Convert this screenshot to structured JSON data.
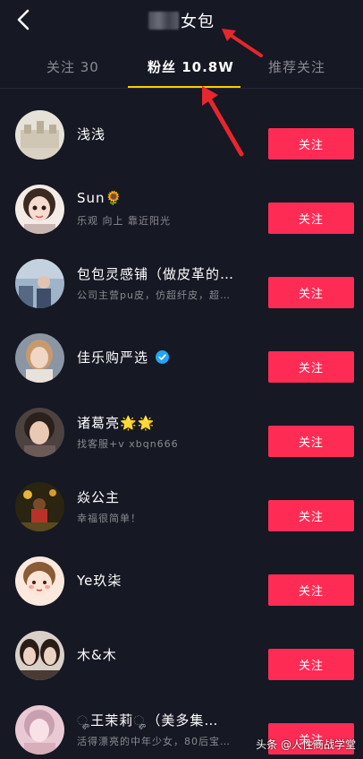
{
  "header": {
    "title_visible": "女包"
  },
  "tabs": [
    {
      "label": "关注 30"
    },
    {
      "label": "粉丝 10.8W"
    },
    {
      "label": "推荐关注"
    }
  ],
  "follow_label": "关注",
  "users": [
    {
      "name": "浅浅",
      "sub": ""
    },
    {
      "name": "Sun🌻",
      "sub": "乐观   向上   靠近阳光"
    },
    {
      "name": "包包灵感铺（做皮革的…",
      "sub": "公司主营pu皮，仿超纤皮，超…"
    },
    {
      "name": "佳乐购严选",
      "sub": "",
      "verified": true
    },
    {
      "name": "诸葛亮🌟🌟",
      "sub": "找客服+v   xbqn666"
    },
    {
      "name": "焱公主",
      "sub": "幸福很简单！"
    },
    {
      "name": "Ye玖柒",
      "sub": ""
    },
    {
      "name": "木&木",
      "sub": ""
    },
    {
      "name": "ೄ王茉莉ೄ（美多集…",
      "sub": "活得漂亮的中年少女，80后宝…"
    }
  ],
  "watermark": "头条 @人性商战学堂",
  "colors": {
    "background": "#161823",
    "accent": "#fe2c55",
    "tab_underline": "#facd00",
    "arrow": "#e8262d"
  }
}
